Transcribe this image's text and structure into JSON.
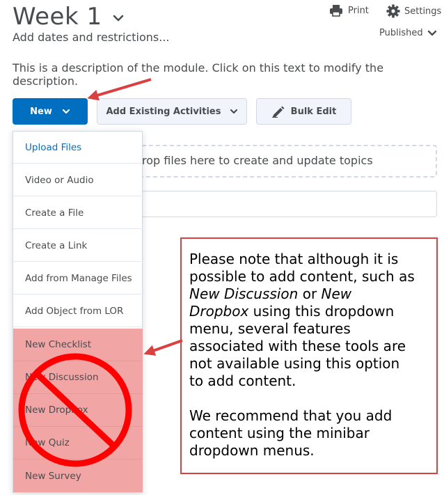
{
  "header": {
    "module_title": "Week 1",
    "print_label": "Print",
    "settings_label": "Settings",
    "status_label": "Published",
    "add_dates_link": "Add dates and restrictions...",
    "description": "This is a description of the module. Click on this text to modify the description."
  },
  "toolbar": {
    "new_label": "New",
    "add_existing_label": "Add Existing Activities",
    "bulk_edit_label": "Bulk Edit"
  },
  "dropzone": {
    "text": "rop files here to create and update topics"
  },
  "new_menu": {
    "items": [
      {
        "label": "Upload Files"
      },
      {
        "label": "Video or Audio"
      },
      {
        "label": "Create a File"
      },
      {
        "label": "Create a Link"
      },
      {
        "label": "Add from Manage Files"
      },
      {
        "label": "Add Object from LOR"
      },
      {
        "label": "New Checklist"
      },
      {
        "label": "New Discussion"
      },
      {
        "label": "New Dropbox"
      },
      {
        "label": "New Quiz"
      },
      {
        "label": "New Survey"
      }
    ]
  },
  "annotation": {
    "line1_a": "Please note that although it is",
    "line2_a": "possible to add content, such as",
    "line3_em1": "New Discussion",
    "line3_or": " or ",
    "line3_em2": "New",
    "line4_em": "Dropbox",
    "line4_rest": " using this dropdown",
    "line5": "menu, several features",
    "line6": "associated with these tools are",
    "line7": "not available using this option",
    "line8": "to add content.",
    "line9": "We recommend that you add",
    "line10": "content using the minibar",
    "line11": "dropdown menus."
  },
  "colors": {
    "primary_blue": "#006fbf",
    "annotation_red": "#d9403f",
    "warning_pink": "#f2a5a5",
    "prohibition_red": "#ff0000"
  },
  "icons": {
    "print": "printer-icon",
    "settings": "gear-icon",
    "bulk_edit": "pencil-icon",
    "dropdown": "chevron-down-icon",
    "prohibition": "no-sign-icon",
    "arrows": "red-arrow-icon"
  }
}
